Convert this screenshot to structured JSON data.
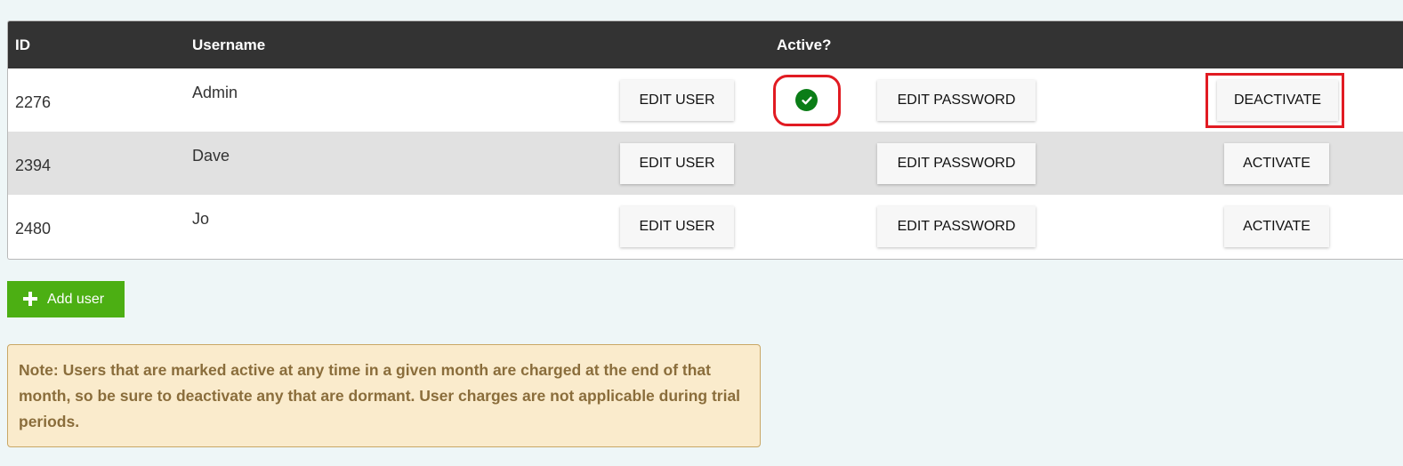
{
  "table": {
    "headers": {
      "id": "ID",
      "username": "Username",
      "active": "Active?"
    },
    "rows": [
      {
        "id": "2276",
        "username": "Admin",
        "edit_user": "EDIT USER",
        "edit_password": "EDIT PASSWORD",
        "toggle": "DEACTIVATE",
        "active": true,
        "active_icon": "check-circle-icon"
      },
      {
        "id": "2394",
        "username": "Dave",
        "edit_user": "EDIT USER",
        "edit_password": "EDIT PASSWORD",
        "toggle": "ACTIVATE",
        "active": false
      },
      {
        "id": "2480",
        "username": "Jo",
        "edit_user": "EDIT USER",
        "edit_password": "EDIT PASSWORD",
        "toggle": "ACTIVATE",
        "active": false
      }
    ]
  },
  "add_user": {
    "label": "Add user",
    "icon": "plus-icon"
  },
  "note": {
    "text": "Note: Users that are marked active at any time in a given month are charged at the end of that month, so be sure to deactivate any that are dormant. User charges are not applicable during trial periods."
  },
  "colors": {
    "header_bg": "#333333",
    "row_alt_bg": "#e1e1e1",
    "add_button": "#4caf13",
    "active_check": "#0b7d17",
    "highlight": "#e11b22",
    "note_bg": "#faebcc",
    "note_text": "#8a6d3b"
  }
}
